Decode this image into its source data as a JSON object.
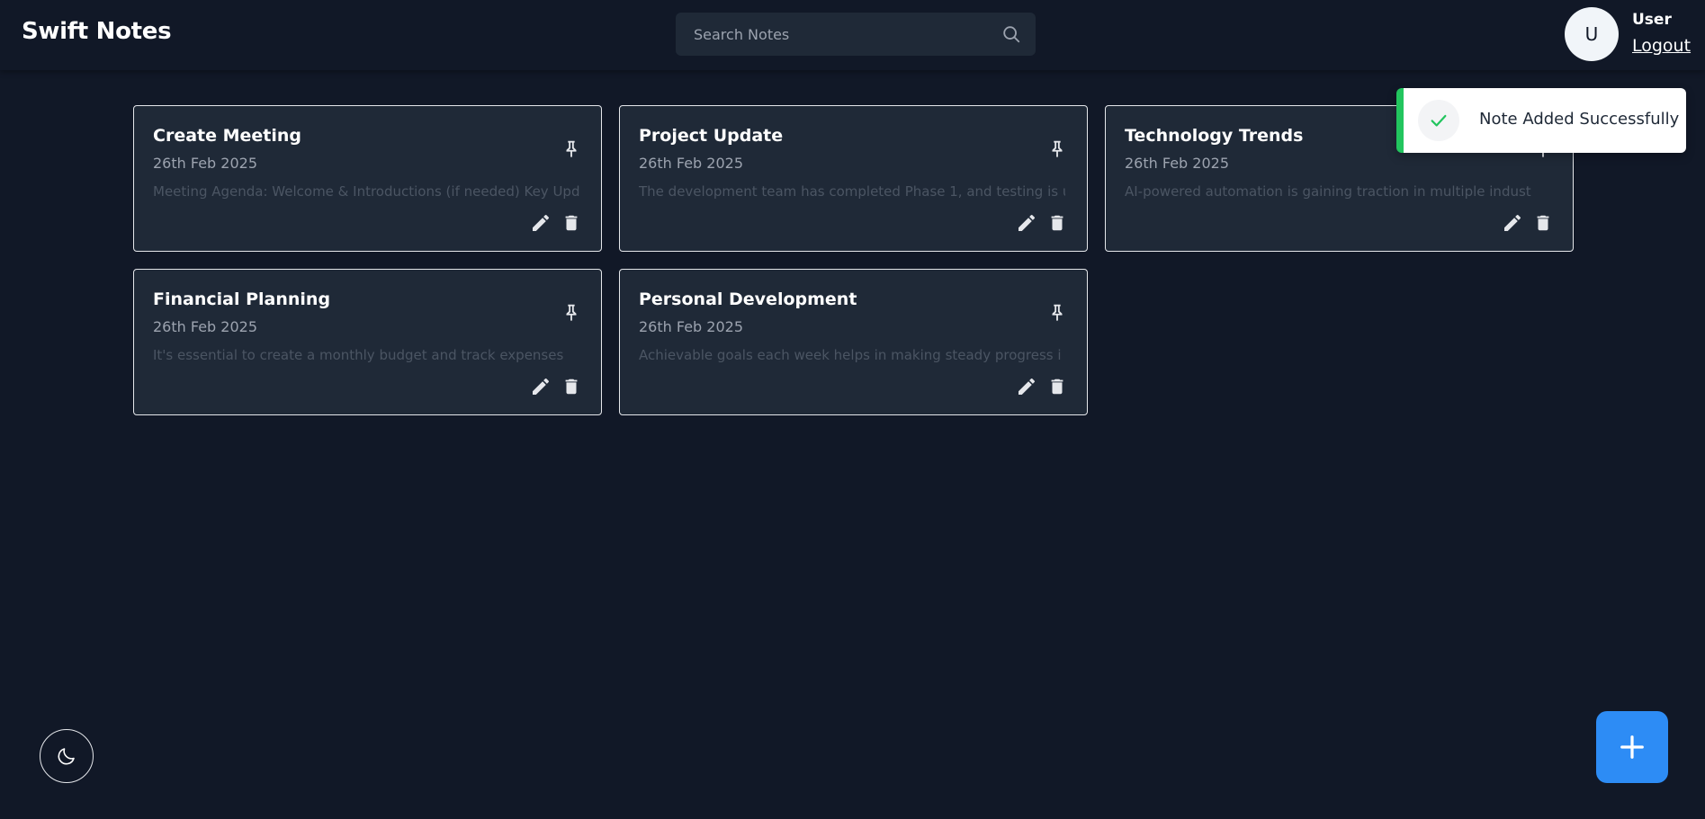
{
  "header": {
    "app_title": "Swift Notes",
    "search": {
      "placeholder": "Search Notes",
      "value": ""
    },
    "user": {
      "initial": "U",
      "name": "User",
      "logout_label": "Logout"
    }
  },
  "notes": [
    {
      "title": "Create Meeting",
      "date": "26th Feb 2025",
      "content": "Meeting Agenda: Welcome & Introductions (if needed) Key Upd"
    },
    {
      "title": "Project Update",
      "date": "26th Feb 2025",
      "content": "The development team has completed Phase 1, and testing is u"
    },
    {
      "title": "Technology Trends",
      "date": "26th Feb 2025",
      "content": "AI-powered automation is gaining traction in multiple indust"
    },
    {
      "title": "Financial Planning",
      "date": "26th Feb 2025",
      "content": "It's essential to create a monthly budget and track expenses"
    },
    {
      "title": "Personal Development",
      "date": "26th Feb 2025",
      "content": "Achievable goals each week helps in making steady progress i"
    }
  ],
  "toast": {
    "message": "Note Added Successfully",
    "status_color": "#22c55e"
  },
  "controls": {
    "theme_icon": "moon-icon",
    "add_icon": "plus-icon",
    "accent": "#2d8cf5"
  }
}
